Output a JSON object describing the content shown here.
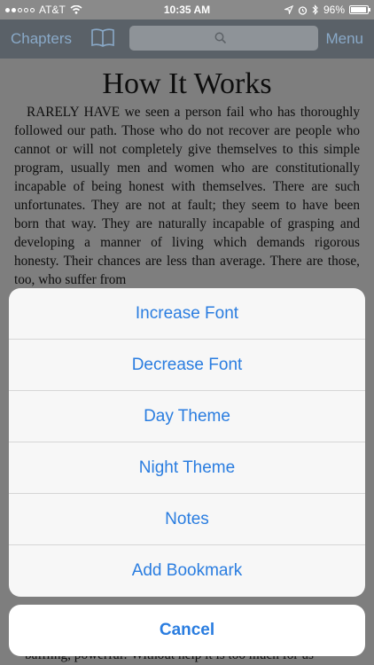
{
  "status_bar": {
    "carrier": "AT&T",
    "time": "10:35 AM",
    "battery": "96%"
  },
  "nav": {
    "chapters_label": "Chapters",
    "menu_label": "Menu",
    "search_placeholder": ""
  },
  "content": {
    "title": "How It Works",
    "body": "RARELY HAVE we seen a person fail who has thoroughly followed our path. Those who do not recover are people who cannot or will not completely give themselves to this simple program, usually men and women who are constitutionally incapable of being honest with themselves. There are such unfortunates. They are not at fault; they seem to have been born that way. They are naturally incapable of grasping and developing a manner of living which demands rigorous honesty. Their chances are less than average. There are those, too, who suffer from",
    "bottom_text": "baffling, powerful! Without help it is too much for us"
  },
  "action_sheet": {
    "items": [
      {
        "label": "Increase Font"
      },
      {
        "label": "Decrease Font"
      },
      {
        "label": "Day Theme"
      },
      {
        "label": "Night Theme"
      },
      {
        "label": "Notes"
      },
      {
        "label": "Add Bookmark"
      }
    ],
    "cancel_label": "Cancel"
  },
  "colors": {
    "accent": "#2a7de0",
    "nav_bg": "#5a6168"
  }
}
